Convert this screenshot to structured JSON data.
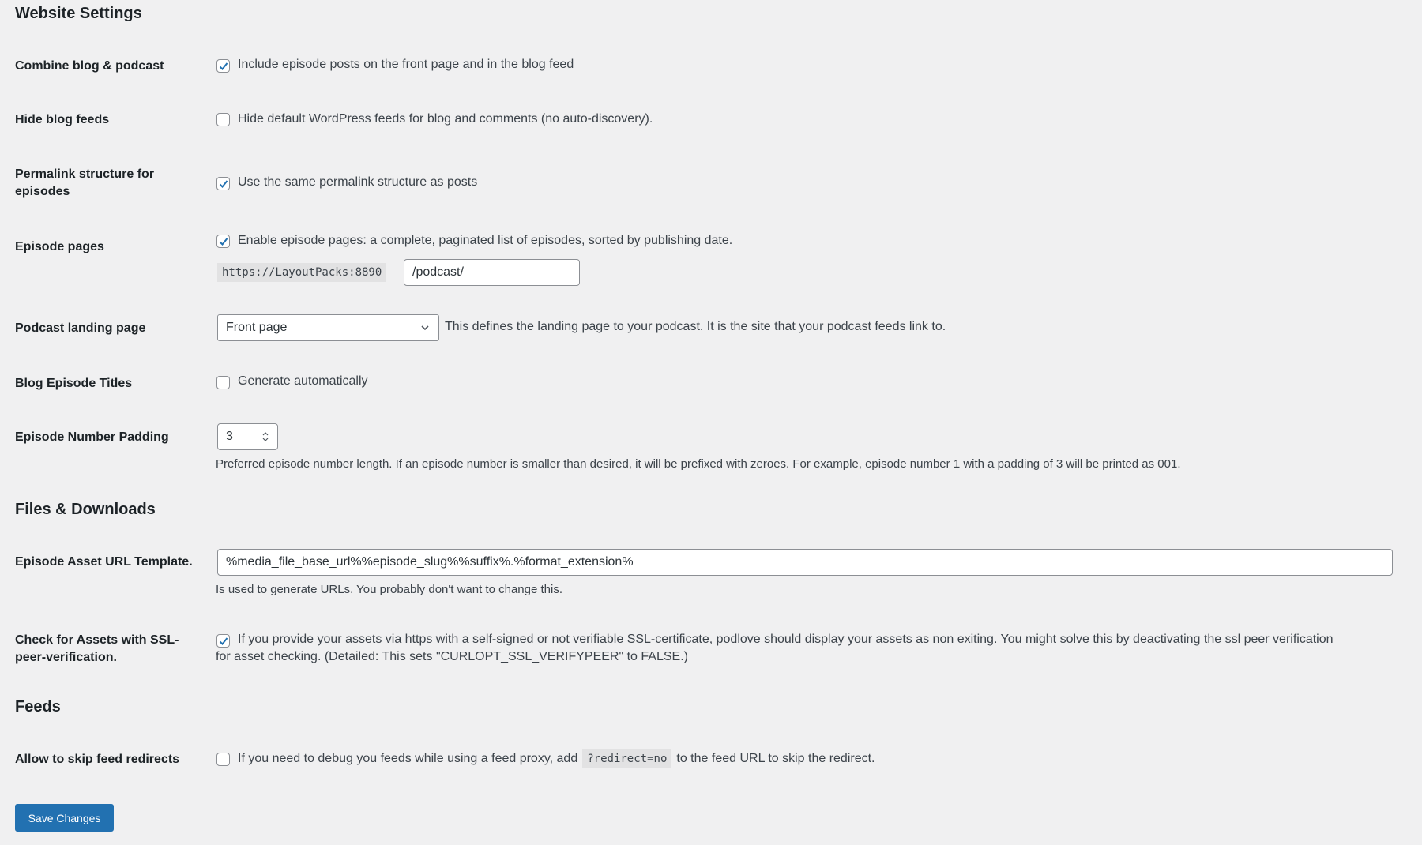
{
  "sections": {
    "website": "Website Settings",
    "files": "Files & Downloads",
    "feeds": "Feeds"
  },
  "rows": {
    "combine": {
      "label": "Combine blog & podcast",
      "checked": true,
      "text": "Include episode posts on the front page and in the blog feed"
    },
    "hide_feeds": {
      "label": "Hide blog feeds",
      "checked": false,
      "text": "Hide default WordPress feeds for blog and comments (no auto-discovery)."
    },
    "permalink": {
      "label": "Permalink structure for episodes",
      "checked": true,
      "text": "Use the same permalink structure as posts"
    },
    "episode_pages": {
      "label": "Episode pages",
      "checked": true,
      "text": "Enable episode pages: a complete, paginated list of episodes, sorted by publishing date.",
      "base_url": "https://LayoutPacks:8890",
      "slug_value": "/podcast/"
    },
    "landing": {
      "label": "Podcast landing page",
      "selected": "Front page",
      "text": "This defines the landing page to your podcast. It is the site that your podcast feeds link to."
    },
    "blog_titles": {
      "label": "Blog Episode Titles",
      "checked": false,
      "text": "Generate automatically"
    },
    "padding": {
      "label": "Episode Number Padding",
      "value": "3",
      "help": "Preferred episode number length. If an episode number is smaller than desired, it will be prefixed with zeroes. For example, episode number 1 with a padding of 3 will be printed as 001."
    },
    "asset_url": {
      "label": "Episode Asset URL Template.",
      "value": "%media_file_base_url%%episode_slug%%suffix%.%format_extension%",
      "help": "Is used to generate URLs. You probably don't want to change this."
    },
    "ssl": {
      "label_line1": "Check for Assets with SSL-",
      "label_line2": "peer-verification.",
      "checked": true,
      "text_line1": "If you provide your assets via https with a self-signed or not verifiable SSL-certificate, podlove should display your assets as non exiting. You might solve this by deactivating the ssl peer verification",
      "text_line2": "for asset checking. (Detailed: This sets \"CURLOPT_SSL_VERIFYPEER\" to FALSE.)"
    },
    "skip_redirects": {
      "label": "Allow to skip feed redirects",
      "checked": false,
      "text_before": "If you need to debug you feeds while using a feed proxy, add",
      "code": "?redirect=no",
      "text_after": "to the feed URL to skip the redirect."
    }
  },
  "save_button": "Save Changes",
  "colors": {
    "accent": "#2271b1",
    "background": "#f0f0f1"
  }
}
